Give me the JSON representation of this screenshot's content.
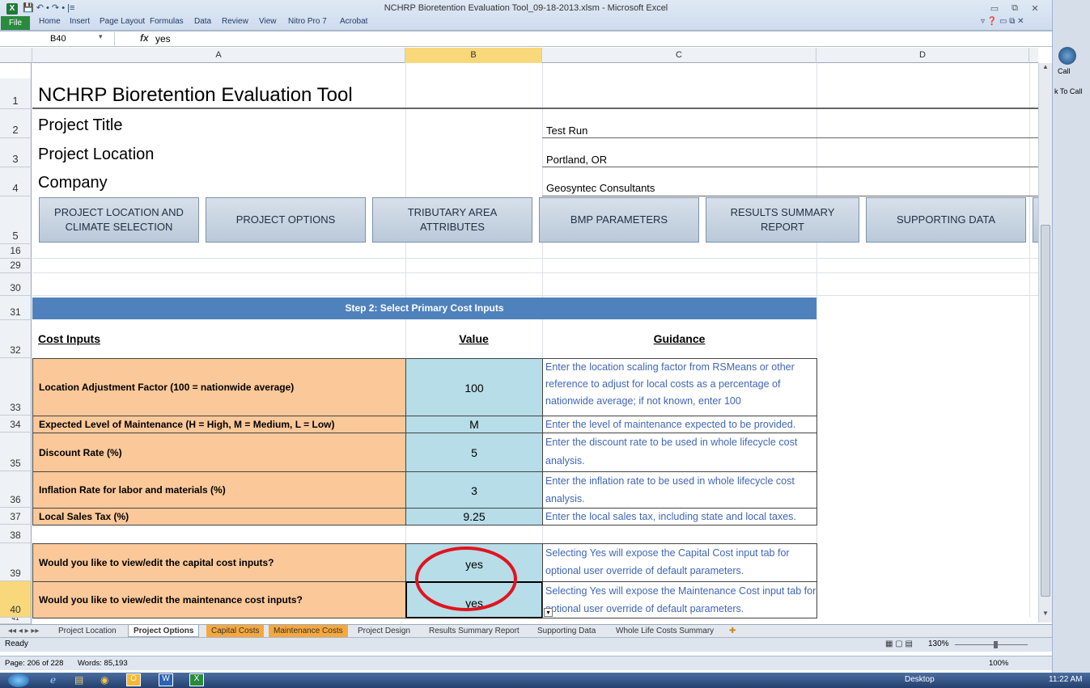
{
  "window": {
    "title": "NCHRP Bioretention Evaluation Tool_09-18-2013.xlsm - Microsoft Excel",
    "app_icon": "X",
    "quick_access": "💾 ↶ • ↷ • |≡"
  },
  "ribbon": {
    "file": "File",
    "tabs": [
      "Home",
      "Insert",
      "Page Layout",
      "Formulas",
      "Data",
      "Review",
      "View",
      "Nitro Pro 7",
      "Acrobat"
    ]
  },
  "formula_bar": {
    "cell_ref": "B40",
    "fx": "fx",
    "value": "yes"
  },
  "columns": [
    "A",
    "B",
    "C",
    "D"
  ],
  "rows": {
    "r1": "1",
    "r2": "2",
    "r3": "3",
    "r4": "4",
    "r5": "5",
    "r16": "16",
    "r29": "29",
    "r30": "30",
    "r31": "31",
    "r32": "32",
    "r33": "33",
    "r34": "34",
    "r35": "35",
    "r36": "36",
    "r37": "37",
    "r38": "38",
    "r39": "39",
    "r40": "40",
    "r41": "41"
  },
  "sheet": {
    "title": "NCHRP Bioretention Evaluation Tool",
    "project_title_label": "Project Title",
    "project_title_value": "Test Run",
    "project_location_label": "Project Location",
    "project_location_value": "Portland, OR",
    "company_label": "Company",
    "company_value": "Geosyntec Consultants",
    "nav_buttons": [
      "PROJECT LOCATION AND CLIMATE SELECTION",
      "PROJECT OPTIONS",
      "TRIBUTARY AREA ATTRIBUTES",
      "BMP PARAMETERS",
      "RESULTS SUMMARY REPORT",
      "SUPPORTING DATA"
    ],
    "step_header": "Step 2: Select Primary Cost Inputs",
    "col_headers": {
      "cost_inputs": "Cost Inputs",
      "value": "Value",
      "guidance": "Guidance"
    },
    "inputs": [
      {
        "label": "Location Adjustment Factor (100 = nationwide average)",
        "value": "100",
        "guidance": [
          "Enter the location scaling factor from RSMeans or other",
          "reference to adjust for local costs as a percentage of",
          "nationwide average; if not known, enter 100"
        ]
      },
      {
        "label": "Expected Level of Maintenance (H = High, M = Medium, L = Low)",
        "value": "M",
        "guidance": [
          "Enter the level of maintenance expected to be provided."
        ]
      },
      {
        "label": "Discount Rate (%)",
        "value": "5",
        "guidance": [
          "Enter the discount rate to be used in whole lifecycle cost",
          "analysis."
        ]
      },
      {
        "label": "Inflation Rate for labor and materials (%)",
        "value": "3",
        "guidance": [
          "Enter the inflation rate to be used in whole lifecycle cost",
          "analysis."
        ]
      },
      {
        "label": "Local Sales Tax (%)",
        "value": "9.25",
        "guidance": [
          "Enter the local sales tax, including state and local taxes."
        ]
      }
    ],
    "view_inputs": [
      {
        "label": "Would you like to view/edit the capital cost inputs?",
        "value": "yes",
        "guidance": [
          "Selecting Yes will expose the Capital Cost input tab for",
          "optional user override of default parameters."
        ]
      },
      {
        "label": "Would you like to view/edit the maintenance cost inputs?",
        "value": "yes",
        "guidance": [
          "Selecting Yes will expose the Maintenance Cost input tab for",
          "optional user override of default parameters."
        ]
      }
    ]
  },
  "sheet_tabs": [
    "Project Location",
    "Project Options",
    "Capital Costs",
    "Maintenance Costs",
    "Project Design",
    "Results Summary Report",
    "Supporting Data",
    "Whole Life Costs Summary"
  ],
  "status": {
    "ready": "Ready",
    "zoom": "130%"
  },
  "word_status": {
    "page": "Page: 206 of 228",
    "words": "Words: 85,193",
    "zoom": "100%"
  },
  "taskbar": {
    "desktop": "Desktop",
    "time": "11:22 AM"
  },
  "right_pane": {
    "call": "Call",
    "click_to_call": "k To Call"
  },
  "colors": {
    "step_header": "#4f81bd",
    "input_label": "#fbc899",
    "input_value": "#b7dde8",
    "guidance_text": "#3f66b8",
    "highlight_circle": "#e0141e"
  }
}
